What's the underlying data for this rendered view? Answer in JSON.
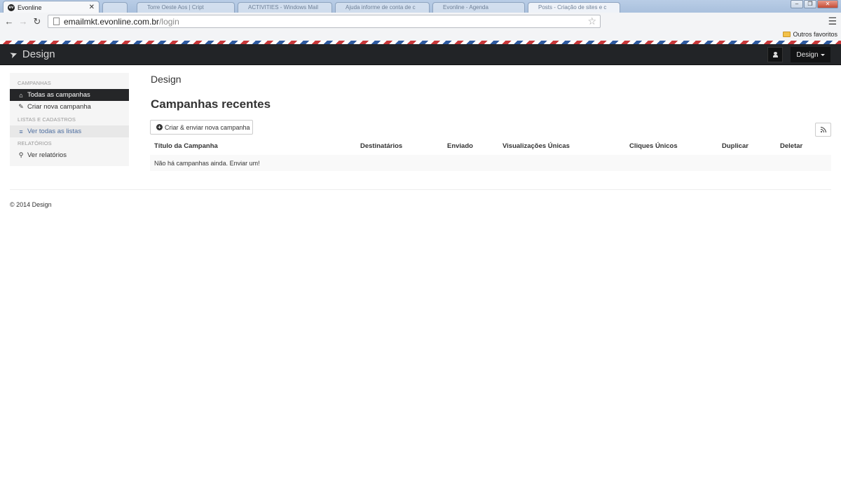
{
  "browser": {
    "active_tab": {
      "title": "Evonline",
      "favicon": "evonline-favicon"
    },
    "background_tabs": [
      "Torre Oeste Aos | Cript",
      "ACTIVITIES - Windows Mail",
      "Ajuda informe de conta de c",
      "Evonline - Agenda",
      "Posts - Criação de sites e c"
    ],
    "url": {
      "host": "emailmkt.evonline.com.br",
      "path": "/login"
    },
    "bookmarks": [
      {
        "label": "Outros favoritos",
        "icon": "folder-icon"
      }
    ]
  },
  "navbar": {
    "brand": "Design",
    "brand_icon": "paper-plane-icon",
    "user_icon": "user-icon",
    "user_menu_label": "Design"
  },
  "sidebar": {
    "sections": [
      {
        "header": "CAMPANHAS"
      },
      {
        "header": "LISTAS E CADASTROS"
      },
      {
        "header": "RELATÓRIOS"
      }
    ],
    "items": [
      {
        "label": "Todas as campanhas",
        "icon": "home-icon",
        "state": "active"
      },
      {
        "label": "Criar nova campanha",
        "icon": "edit-icon",
        "state": "default"
      },
      {
        "label": "Ver todas as listas",
        "icon": "list-icon",
        "state": "hover"
      },
      {
        "label": "Ver relatórios",
        "icon": "search-icon",
        "state": "default"
      }
    ]
  },
  "main": {
    "heading": "Design",
    "section_title": "Campanhas recentes",
    "create_button": "Criar & enviar nova campanha",
    "rss_icon": "rss-icon",
    "table": {
      "columns": [
        "Título da Campanha",
        "Destinatários",
        "Enviado",
        "Visualizações Únicas",
        "Cliques Únicos",
        "Duplicar",
        "Deletar"
      ],
      "empty_message": "Não há campanhas ainda. Enviar um!"
    }
  },
  "footer": {
    "text": "© 2014 Design"
  },
  "colors": {
    "navbar_bg": "#222427",
    "sidebar_bg": "#f5f5f5",
    "sidebar_active_bg": "#252628",
    "sidebar_link_hover": "#4d6ea0"
  }
}
